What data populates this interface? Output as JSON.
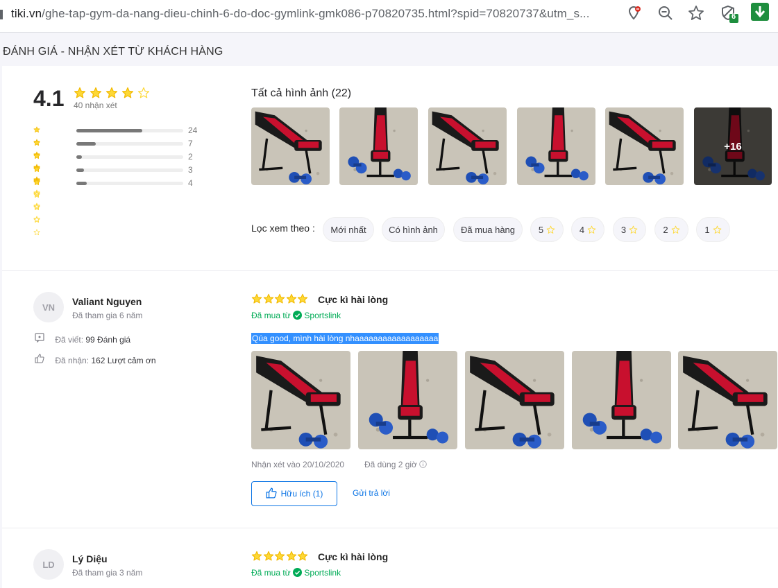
{
  "browser": {
    "url_host": "tiki.vn",
    "url_rest": "/ghe-tap-gym-da-nang-dieu-chinh-6-do-doc-gymlink-gmk086-p70820735.html?spid=70820737&utm_s...",
    "extension_badge": "6",
    "icons": [
      "location-blocked-icon",
      "zoom-out-icon",
      "bookmark-star-icon",
      "shield-extension-icon",
      "download-icon"
    ]
  },
  "section_title": "ĐÁNH GIÁ - NHẬN XÉT TỪ KHÁCH HÀNG",
  "summary": {
    "score": "4.1",
    "stars": 4.1,
    "count_text": "40 nhận xét",
    "distribution": [
      {
        "stars": 5,
        "count": "24",
        "fraction": 0.62
      },
      {
        "stars": 4,
        "count": "7",
        "fraction": 0.18
      },
      {
        "stars": 3,
        "count": "2",
        "fraction": 0.05
      },
      {
        "stars": 2,
        "count": "3",
        "fraction": 0.07
      },
      {
        "stars": 1,
        "count": "4",
        "fraction": 0.1
      }
    ]
  },
  "gallery": {
    "title": "Tất cả hình ảnh (22)",
    "more_overlay": "+16"
  },
  "filter": {
    "label": "Lọc xem theo :",
    "chips": [
      "Mới nhất",
      "Có hình ảnh",
      "Đã mua hàng",
      "5",
      "4",
      "3",
      "2",
      "1"
    ]
  },
  "reviews": [
    {
      "avatar": "VN",
      "name": "Valiant Nguyen",
      "joined": "Đã tham gia 6 năm",
      "written_label": "Đã viết:",
      "written_value": "99 Đánh giá",
      "received_label": "Đã nhận:",
      "received_value": "162 Lượt cảm ơn",
      "title": "Cực kì hài lòng",
      "bought_label": "Đã mua từ",
      "seller": "Sportslink",
      "content": "Qúa good, mình hài lòng nhaaaaaaaaaaaaaaaaaa",
      "date": "Nhận xét vào 20/10/2020",
      "used": "Đã dùng 2 giờ",
      "helpful": "Hữu ích (1)",
      "reply": "Gửi trả lời"
    },
    {
      "avatar": "LD",
      "name": "Lý Diệu",
      "joined": "Đã tham gia 3 năm",
      "title": "Cực kì hài lòng",
      "bought_label": "Đã mua từ",
      "seller": "Sportslink"
    }
  ],
  "colors": {
    "star": "#fdd836",
    "link_blue": "#0b74e5",
    "green": "#00ab56",
    "selection": "#3390ff"
  }
}
